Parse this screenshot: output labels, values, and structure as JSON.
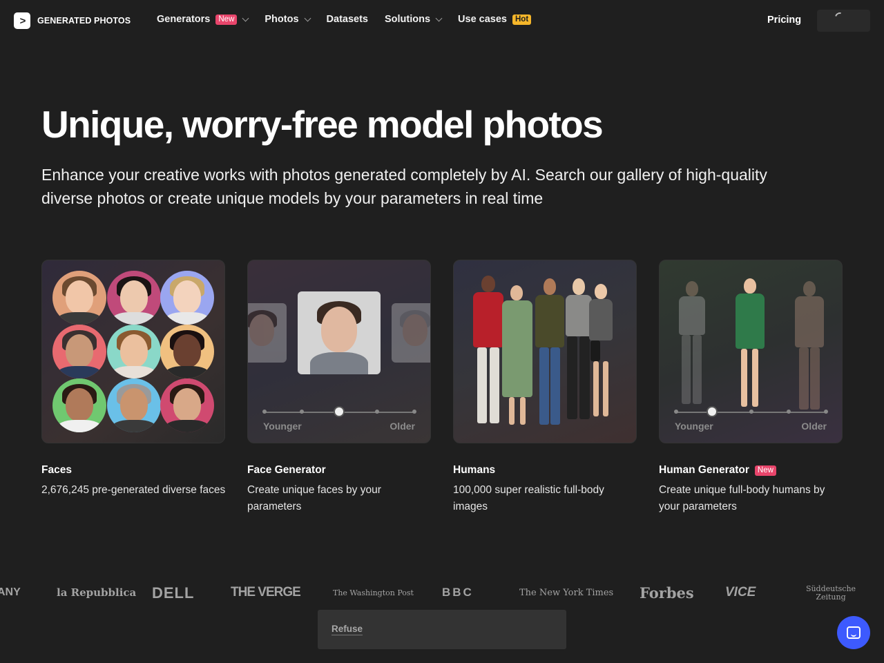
{
  "header": {
    "logo_text": "GENERATED PHOTOS",
    "nav": [
      {
        "label": "Generators",
        "badge": "New",
        "dropdown": true
      },
      {
        "label": "Photos",
        "dropdown": true
      },
      {
        "label": "Datasets"
      },
      {
        "label": "Solutions",
        "dropdown": true
      },
      {
        "label": "Use cases",
        "badge": "Hot"
      }
    ],
    "pricing": "Pricing"
  },
  "hero": {
    "title": "Unique, worry-free model photos",
    "subtitle": "Enhance your creative works with photos generated completely by AI. Search our gallery of high-quality diverse photos or create unique models by your parameters in real time"
  },
  "cards": [
    {
      "title": "Faces",
      "desc": "2,676,245 pre-generated diverse faces"
    },
    {
      "title": "Face Generator",
      "desc": "Create unique faces by your parameters",
      "slider_left": "Younger",
      "slider_right": "Older"
    },
    {
      "title": "Humans",
      "desc": "100,000 super realistic full-body images"
    },
    {
      "title": "Human Generator",
      "badge": "New",
      "desc": "Create unique full-body humans by your parameters",
      "slider_left": "Younger",
      "slider_right": "Older"
    }
  ],
  "press_logos": [
    "ANY",
    "la Repubblica",
    "DELL",
    "THE VERGE",
    "The Washington Post",
    "BBC",
    "The New York Times",
    "Forbes",
    "VICE",
    "Süddeutsche Zeitung"
  ],
  "consent": {
    "refuse": "Refuse"
  },
  "colors": {
    "background": "#1f1f1f",
    "badge_new": "#e8456b",
    "badge_hot": "#f5b62a",
    "chat": "#3d5afe"
  }
}
